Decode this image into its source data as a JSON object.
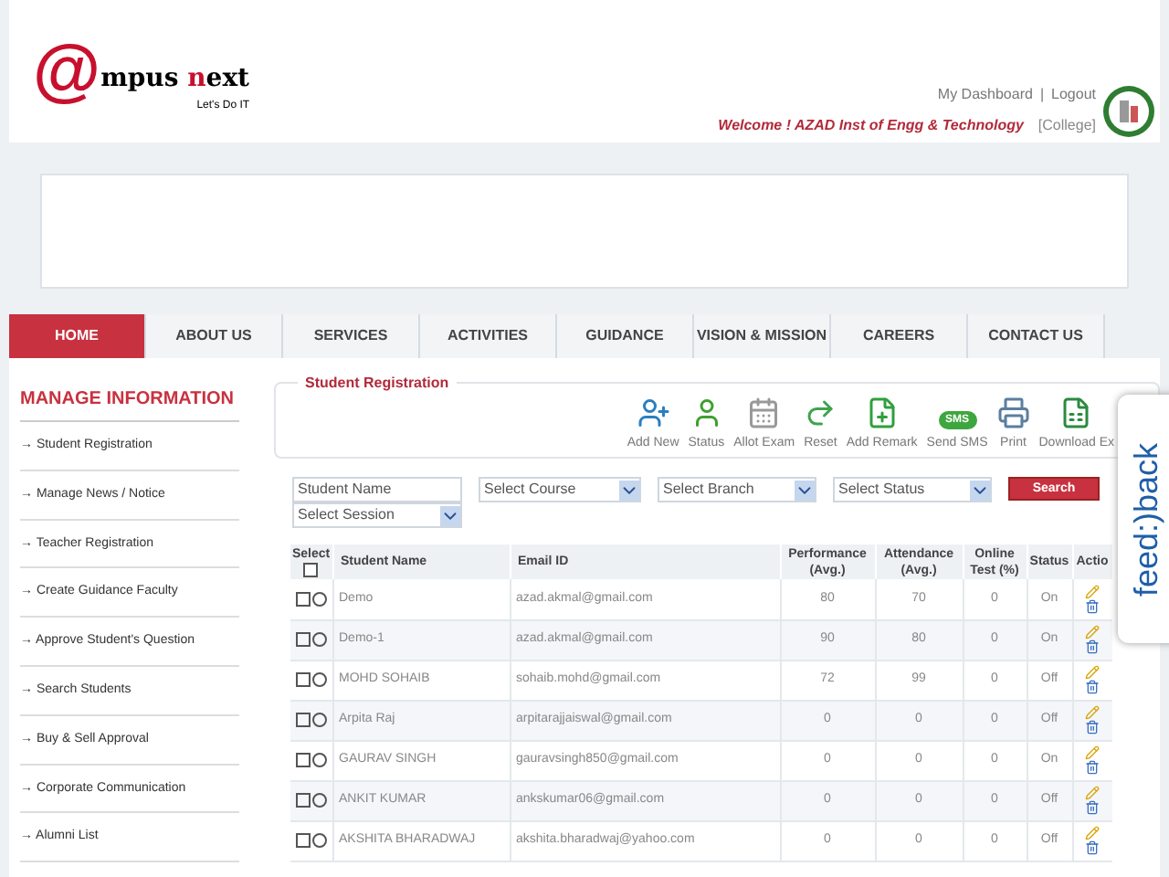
{
  "logo": {
    "mark": "@",
    "word_start": "mpus ",
    "word_accent": "n",
    "word_end": "ext",
    "tagline": "Let's Do IT"
  },
  "header_links": [
    {
      "label": "My Dashboard"
    },
    {
      "label": "Logout"
    }
  ],
  "link_separator": "|",
  "welcome": "Welcome ! AZAD Inst of Engg & Technology",
  "role": "[College]",
  "nav": [
    {
      "label": "HOME",
      "selected": true
    },
    {
      "label": "ABOUT US",
      "selected": false
    },
    {
      "label": "SERVICES",
      "selected": false
    },
    {
      "label": "ACTIVITIES",
      "selected": false
    },
    {
      "label": "GUIDANCE",
      "selected": false
    },
    {
      "label": "VISION & MISSION",
      "selected": false
    },
    {
      "label": "CAREERS",
      "selected": false
    },
    {
      "label": "CONTACT US",
      "selected": false
    }
  ],
  "sidebar": {
    "title": "MANAGE INFORMATION",
    "items": [
      {
        "label": "→ Student Registration"
      },
      {
        "label": "→ Manage News / Notice"
      },
      {
        "label": "→ Teacher Registration"
      },
      {
        "label": "→ Create Guidance Faculty"
      },
      {
        "label": "→ Approve Student's Question"
      },
      {
        "label": "→ Search Students"
      },
      {
        "label": "→ Buy & Sell Approval"
      },
      {
        "label": "→ Corporate Communication"
      },
      {
        "label": "→ Alumni List"
      }
    ]
  },
  "panel_title": "Student Registration",
  "toolbar": [
    {
      "kind": "add",
      "label": "Add New"
    },
    {
      "kind": "status",
      "label": "Status"
    },
    {
      "kind": "exam",
      "label": "Allot Exam"
    },
    {
      "kind": "reset",
      "label": "Reset"
    },
    {
      "kind": "remark",
      "label": "Add Remark"
    },
    {
      "kind": "sms",
      "label": "Send SMS",
      "badge": "SMS"
    },
    {
      "kind": "print",
      "label": "Print"
    },
    {
      "kind": "excel",
      "label": "Download Ex"
    }
  ],
  "filters": {
    "student_name": {
      "value": "Student Name"
    },
    "course": {
      "value": "Select Course"
    },
    "branch": {
      "value": "Select Branch"
    },
    "status": {
      "value": "Select Status"
    },
    "session": {
      "value": "Select Session"
    },
    "search_button": "Search"
  },
  "table": {
    "columns": [
      "Select",
      "Student Name",
      "Email ID",
      "Performance (Avg.)",
      "Attendance (Avg.)",
      "Online Test (%)",
      "Status",
      "Actio"
    ],
    "select_all": {
      "checked": false
    },
    "rows": [
      {
        "checked": false,
        "selected": false,
        "name": "Demo",
        "email": "azad.akmal@gmail.com",
        "performance": "80",
        "attendance": "70",
        "online_test": "0",
        "status": "On"
      },
      {
        "checked": false,
        "selected": false,
        "name": "Demo-1",
        "email": "azad.akmal@gmail.com",
        "performance": "90",
        "attendance": "80",
        "online_test": "0",
        "status": "On"
      },
      {
        "checked": false,
        "selected": false,
        "name": "MOHD SOHAIB",
        "email": "sohaib.mohd@gmail.com",
        "performance": "72",
        "attendance": "99",
        "online_test": "0",
        "status": "Off"
      },
      {
        "checked": false,
        "selected": false,
        "name": "Arpita Raj",
        "email": "arpitarajjaiswal@gmail.com",
        "performance": "0",
        "attendance": "0",
        "online_test": "0",
        "status": "Off"
      },
      {
        "checked": false,
        "selected": false,
        "name": "GAURAV SINGH",
        "email": "gauravsingh850@gmail.com",
        "performance": "0",
        "attendance": "0",
        "online_test": "0",
        "status": "On"
      },
      {
        "checked": false,
        "selected": false,
        "name": "ANKIT KUMAR",
        "email": "ankskumar06@gmail.com",
        "performance": "0",
        "attendance": "0",
        "online_test": "0",
        "status": "Off"
      },
      {
        "checked": false,
        "selected": false,
        "name": "AKSHITA BHARADWAJ",
        "email": "akshita.bharadwaj@yahoo.com",
        "performance": "0",
        "attendance": "0",
        "online_test": "0",
        "status": "Off"
      }
    ]
  },
  "feedback_tab": "feed:)back"
}
